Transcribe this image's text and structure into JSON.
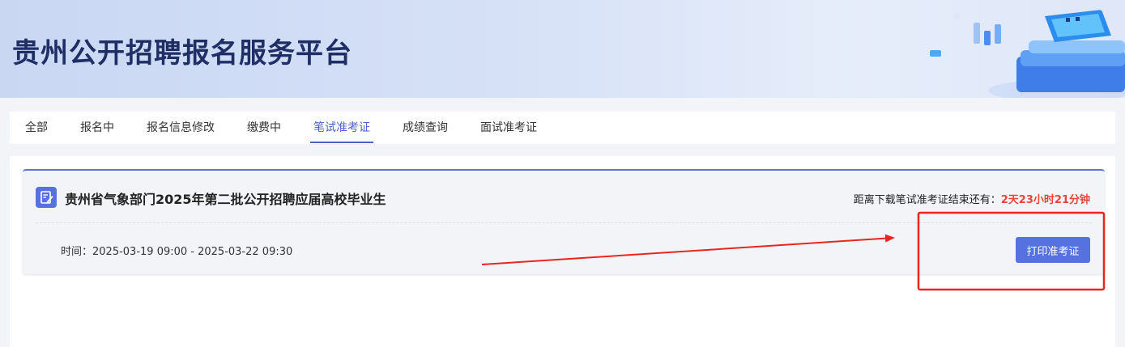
{
  "header": {
    "title": "贵州公开招聘报名服务平台"
  },
  "tabs": [
    {
      "label": "全部"
    },
    {
      "label": "报名中"
    },
    {
      "label": "报名信息修改"
    },
    {
      "label": "缴费中"
    },
    {
      "label": "笔试准考证",
      "active": true
    },
    {
      "label": "成绩查询"
    },
    {
      "label": "面试准考证"
    }
  ],
  "exam": {
    "title": "贵州省气象部门2025年第二批公开招聘应届高校毕业生",
    "countdown_label": "距离下载笔试准考证结束还有：",
    "countdown_value": "2天23小时21分钟",
    "time_label": "时间：",
    "time_value": "2025-03-19 09:00 - 2025-03-22 09:30",
    "print_button": "打印准考证"
  },
  "colors": {
    "accent": "#5671e0",
    "countdown": "#e8443a",
    "annotation": "#e8251f"
  },
  "icons": {
    "exam_icon": "edit-document-icon"
  }
}
